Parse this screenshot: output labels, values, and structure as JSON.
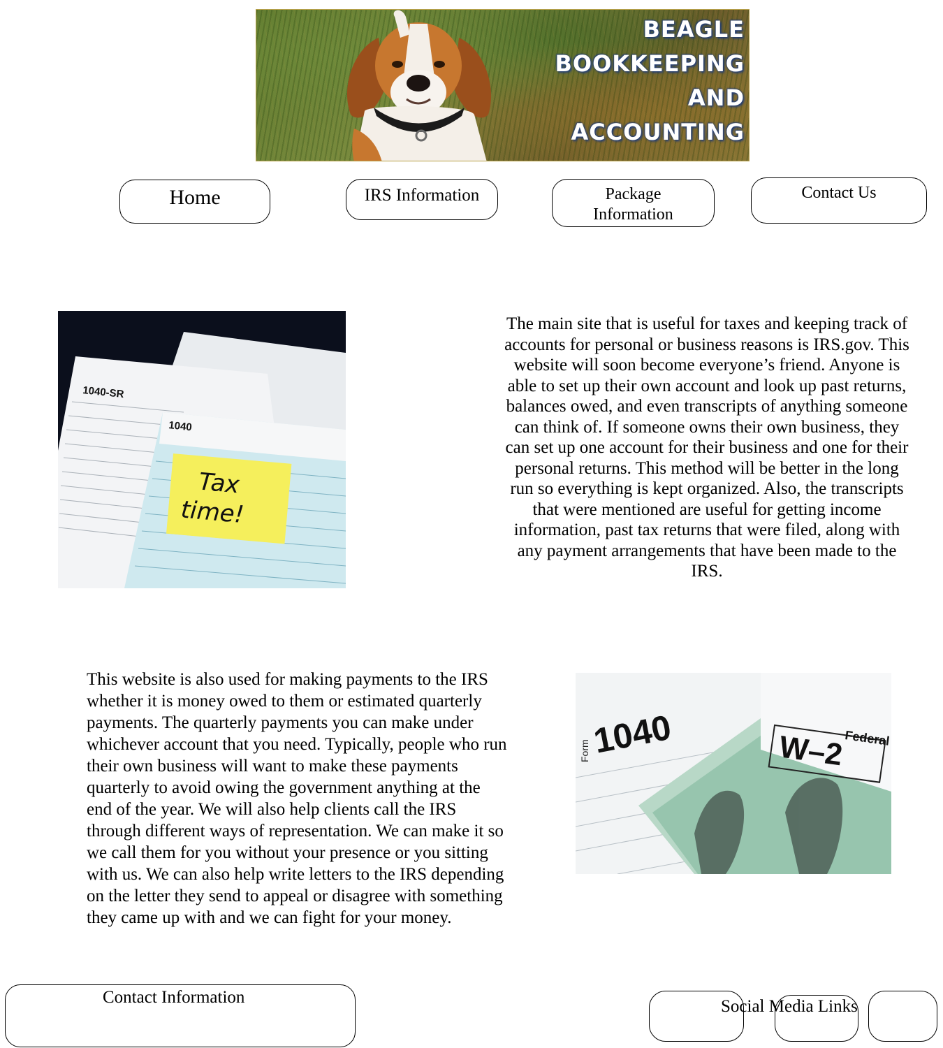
{
  "banner": {
    "title_line1": "BEAGLE",
    "title_line2": "BOOKKEEPING",
    "title_line3": "AND",
    "title_line4": "ACCOUNTING"
  },
  "nav": {
    "home": "Home",
    "irs": "IRS Information",
    "package_line1": "Package",
    "package_line2": "Information",
    "contact": "Contact Us"
  },
  "images": {
    "tax_note_line1": "Tax",
    "tax_note_line2": "time!",
    "form_1040sr": "1040-SR",
    "form_1040": "1040",
    "form_w2": "W–2",
    "form_label": "Form",
    "w2_federal": "Federal"
  },
  "content": {
    "irs_site_paragraph": "The main site that is useful for taxes and keeping track of accounts for personal or business reasons is IRS.gov.  This website will soon become everyone’s friend.  Anyone is able to set up their own account and look up past returns, balances owed, and even transcripts of anything someone can think of.  If someone owns their own business, they can set up one account for their business and one for their personal returns.  This method will be better in the long run so everything is kept organized.  Also, the transcripts that were mentioned are useful for getting income information, past tax returns that were filed, along with any payment arrangements that have been made to the IRS.",
    "payments_paragraph": "This website is also used for making payments to the IRS whether it is money owed to them or estimated quarterly payments.  The quarterly payments you can make under whichever account that you need.  Typically, people who run their own business will want to make these payments quarterly to avoid owing the government anything at the end of the year.  We will also help clients call the IRS through different ways of representation.  We can make it so we call them for you without your presence or you sitting with us.  We can also help write letters to the IRS depending on the letter they send to appeal or disagree with something they came up with and we can fight for your money."
  },
  "footer": {
    "contact_info": "Contact Information",
    "social_links": "Social Media Links"
  }
}
